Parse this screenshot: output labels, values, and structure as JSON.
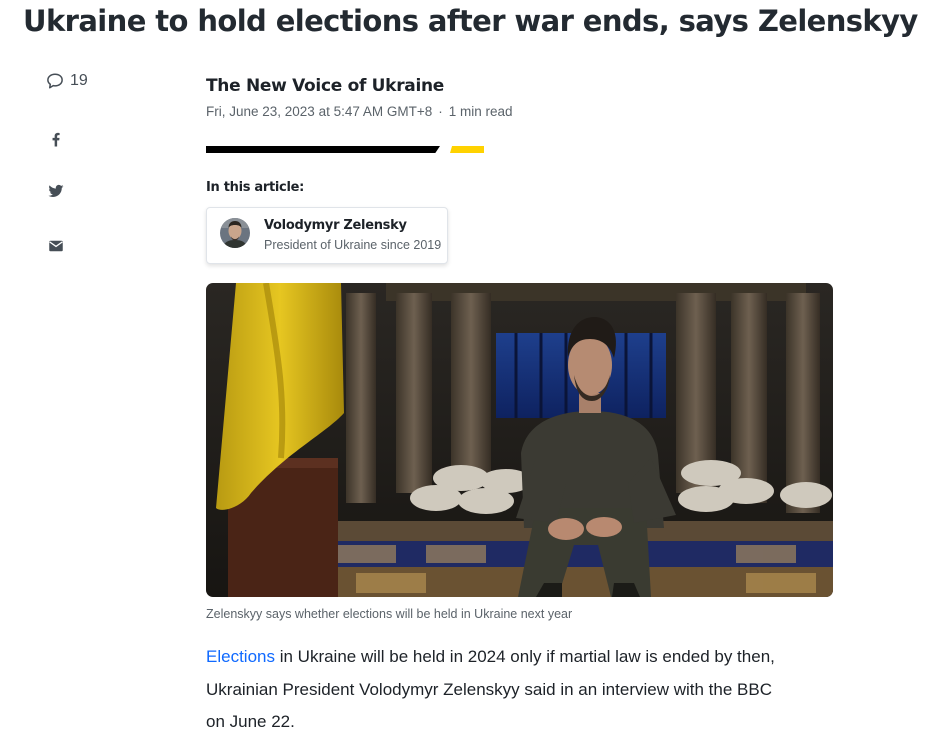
{
  "article": {
    "headline": "Ukraine to hold elections after war ends, says Zelenskyy",
    "source": "The New Voice of Ukraine",
    "date": "Fri, June 23, 2023 at 5:47 AM GMT+8",
    "separator": "·",
    "read_time": "1 min read",
    "in_this_article_label": "In this article:",
    "caption": "Zelenskyy says whether elections will be held in Ukraine next year",
    "body": {
      "link_text": "Elections",
      "line1_rest": " in Ukraine will be held in 2024 only if martial law is ended by then,",
      "line2": "Ukrainian President Volodymyr Zelenskyy said in an interview with the BBC",
      "line3": "on June 22."
    }
  },
  "share_rail": {
    "comment_count": "19",
    "icons": [
      "comment-icon",
      "facebook-icon",
      "twitter-icon",
      "mail-icon"
    ]
  },
  "entity": {
    "name": "Volodymyr Zelensky",
    "role": "President of Ukraine since 2019"
  },
  "colors": {
    "link": "#0f69ff",
    "accent_yellow": "#ffd200",
    "text": "#1d2228",
    "muted": "#5b636a",
    "icon": "#464e56"
  }
}
